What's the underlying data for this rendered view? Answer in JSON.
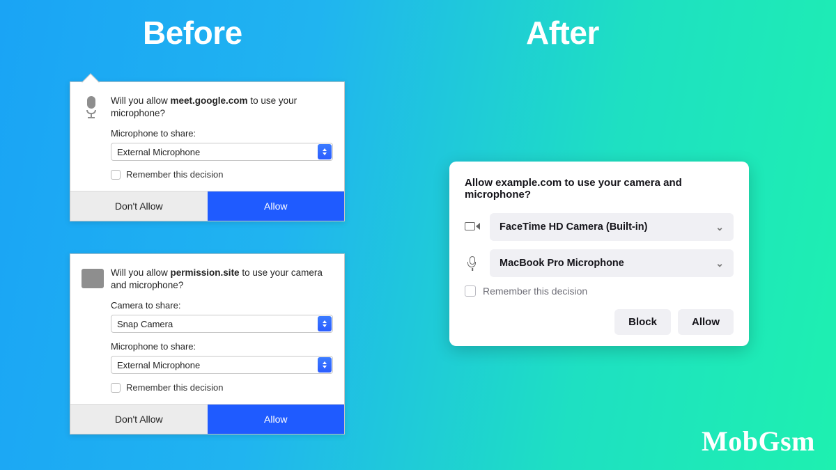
{
  "headings": {
    "before": "Before",
    "after": "After"
  },
  "watermark": "MobGsm",
  "old1": {
    "prompt_pre": "Will you allow ",
    "prompt_site": "meet.google.com",
    "prompt_post": " to use your microphone?",
    "mic_label": "Microphone to share:",
    "mic_value": "External Microphone",
    "remember": "Remember this decision",
    "deny": "Don't Allow",
    "allow": "Allow"
  },
  "old2": {
    "prompt_pre": "Will you allow ",
    "prompt_site": "permission.site",
    "prompt_post": " to use your camera and microphone?",
    "cam_label": "Camera to share:",
    "cam_value": "Snap Camera",
    "mic_label": "Microphone to share:",
    "mic_value": "External Microphone",
    "remember": "Remember this decision",
    "deny": "Don't Allow",
    "allow": "Allow"
  },
  "newd": {
    "title": "Allow example.com to use your camera and microphone?",
    "camera": "FaceTime HD Camera (Built-in)",
    "microphone": "MacBook Pro Microphone",
    "remember": "Remember this decision",
    "block": "Block",
    "allow": "Allow"
  }
}
